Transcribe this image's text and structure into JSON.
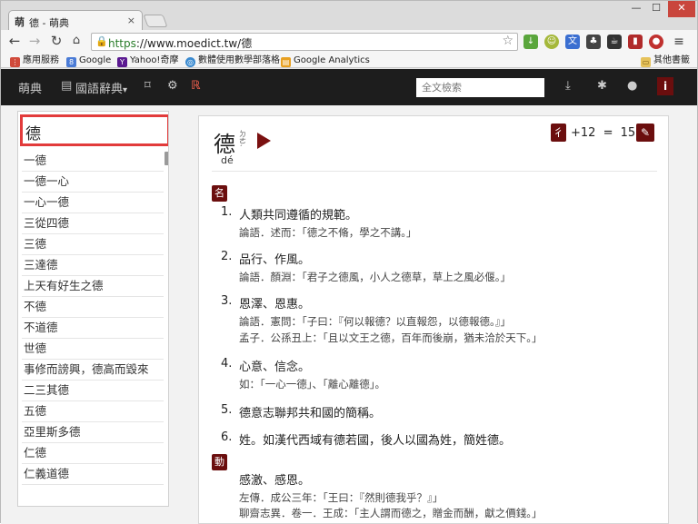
{
  "browser": {
    "tab_title": "德 - 萌典",
    "tab_favicon": "萌",
    "tab_close": "×",
    "window_controls": [
      "—",
      "☐",
      "✕"
    ],
    "url_scheme": "https",
    "url_rest": "://www.moedict.tw/德",
    "bookmarks": [
      {
        "label": "應用服務",
        "icon": "apps-grid-icon",
        "color": "#d04a3b"
      },
      {
        "label": "Google",
        "icon": "google-icon",
        "color": "#4a7bd6"
      },
      {
        "label": "Yahoo!奇摩",
        "icon": "yahoo-icon",
        "color": "#5b1a91"
      },
      {
        "label": "數體使用數學部落格",
        "icon": "globe-icon",
        "color": "#3a8ad0"
      },
      {
        "label": "Google Analytics",
        "icon": "analytics-icon",
        "color": "#e8a021"
      }
    ],
    "other_bookmarks": "其他書籤"
  },
  "sitenav": {
    "logo": "萌典",
    "dictionary": "國語辭典",
    "caret": "▾",
    "search_placeholder": "全文檢索"
  },
  "sidebar": {
    "search_value": "德",
    "words": [
      "一德",
      "一德一心",
      "一心一德",
      "三從四德",
      "三德",
      "三達德",
      "上天有好生之德",
      "不德",
      "不道德",
      "世德",
      "事修而謗興，德高而毀來",
      "二三其德",
      "五德",
      "亞里斯多德",
      "仁德",
      "仁義道德"
    ]
  },
  "entry": {
    "headword": "德",
    "zhuyin": "ㄉㄜˊ",
    "pinyin": "dé",
    "radical": "彳",
    "stroke_formula": "+12 = 15",
    "colors": {
      "accent": "#6b0e0e"
    },
    "groups": [
      {
        "pos": "名",
        "defs": [
          {
            "num": "1.",
            "text": "人類共同遵循的規範。",
            "examples": [
              "論語．述而：「德之不脩，學之不講。」"
            ]
          },
          {
            "num": "2.",
            "text": "品行、作風。",
            "examples": [
              "論語．顏淵：「君子之德風，小人之德草，草上之風必偃。」"
            ]
          },
          {
            "num": "3.",
            "text": "恩澤、恩惠。",
            "examples": [
              "論語．憲問：「子曰：『何以報德？以直報怨，以德報德。』」",
              "孟子．公孫丑上：「且以文王之德，百年而後崩，猶未洽於天下。」"
            ]
          },
          {
            "num": "4.",
            "text": "心意、信念。",
            "examples": [
              "如：「一心一德」、「離心離德」。"
            ]
          },
          {
            "num": "5.",
            "text": "德意志聯邦共和國的簡稱。",
            "examples": []
          },
          {
            "num": "6.",
            "text": "姓。如漢代西域有德若國，後人以國為姓，簡姓德。",
            "examples": []
          }
        ]
      },
      {
        "pos": "動",
        "defs": [
          {
            "num": "",
            "text": "感激、感恩。",
            "examples": [
              "左傳．成公三年：「王曰：『然則德我乎？』」",
              "聊齋志異．卷一．王成：「主人謂而德之，贈金而酬，獻之價錢。」"
            ]
          }
        ]
      }
    ]
  }
}
